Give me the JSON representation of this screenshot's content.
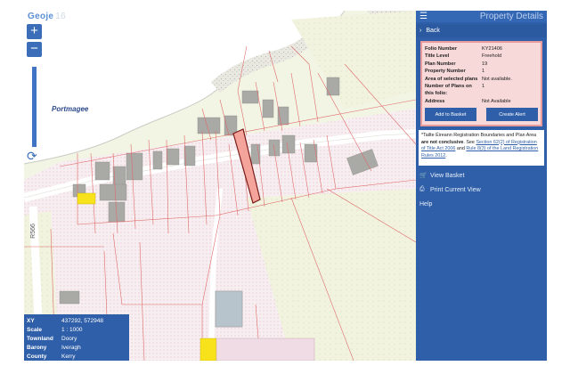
{
  "map": {
    "logo": "Geoje",
    "logo_suffix": "16",
    "zoom_in": "+",
    "zoom_out": "−",
    "place_label": "Portmagee",
    "road_label": "R566"
  },
  "coords": {
    "rows": [
      {
        "k": "XY",
        "v": "437292, 572948"
      },
      {
        "k": "Scale",
        "v": "1 : 1000"
      },
      {
        "k": "Townland",
        "v": "Doory"
      },
      {
        "k": "Barony",
        "v": "Iveragh"
      },
      {
        "k": "County",
        "v": "Kerry"
      }
    ]
  },
  "panel": {
    "title": "Property Details",
    "back": "Back",
    "details": [
      {
        "k": "Folio Number",
        "v": "KY21406"
      },
      {
        "k": "Title Level",
        "v": "Freehold"
      },
      {
        "k": "Plan Number",
        "v": "19"
      },
      {
        "k": "Property Number",
        "v": "1"
      },
      {
        "k": "Area of selected plans",
        "v": "Not available."
      },
      {
        "k": "Number of Plans on this folio:",
        "v": "1"
      },
      {
        "k": "Address",
        "v": "Not Available"
      }
    ],
    "add_to_basket": "Add to Basket",
    "create_alert": "Create Alert",
    "note_prefix": "*Tailte Éireann Registration Boundaries and Plan Area",
    "note_bold": "are not conclusive",
    "note_see": ". See",
    "note_link1": "Section 62(2) of Registration of Title Act 2006",
    "note_and": "and",
    "note_link2": "Rule 8(3) of the Land Registration Rules 2012",
    "note_end": ".",
    "view_basket": "View Basket",
    "print_view": "Print Current View",
    "help": "Help"
  },
  "colors": {
    "panel_blue": "#2f5fa8",
    "selected_parcel": "#f4a49a",
    "parcel_line": "#e06a6a",
    "water": "#ffffff",
    "yellow_plot": "#f7e21b"
  }
}
